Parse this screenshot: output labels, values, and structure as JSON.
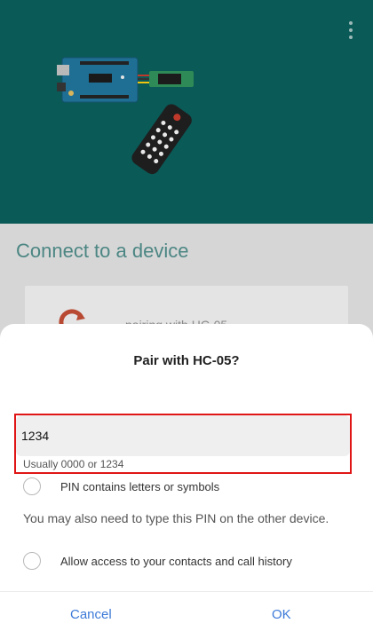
{
  "header": {
    "menu_icon": "more-vert-icon",
    "illustration": "arduino-hc05-ir-remote-illustration"
  },
  "main": {
    "title": "Connect to a device",
    "card": {
      "status_text": "pairing with HC-05",
      "icon": "refresh-icon"
    }
  },
  "dialog": {
    "title": "Pair with HC-05?",
    "pin": {
      "value": "1234",
      "hint": "Usually 0000 or 1234"
    },
    "option_letters": "PIN contains letters or symbols",
    "info": "You may also need to type this PIN on the other device.",
    "option_contacts": "Allow access to your contacts and call history",
    "cancel_label": "Cancel",
    "ok_label": "OK"
  },
  "colors": {
    "header_bg": "#0a5a57",
    "accent": "#3d7ad8",
    "highlight_border": "#e01515"
  }
}
